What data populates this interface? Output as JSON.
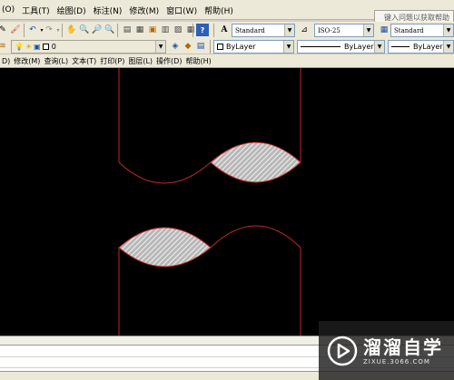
{
  "menubar": {
    "items": [
      "(O)",
      "工具(T)",
      "绘图(D)",
      "标注(N)",
      "修改(M)",
      "窗口(W)",
      "帮助(H)"
    ],
    "help_placeholder": "键入问题以获取帮助"
  },
  "toolbar1": {
    "text_style": "Standard",
    "dim_style": "ISO-25",
    "table_style": "Standard"
  },
  "toolbar2": {
    "layer": "0",
    "color": "ByLayer",
    "linetype": "ByLayer",
    "lineweight": "ByLayer"
  },
  "menubar2": {
    "items": [
      "D)",
      "修改(M)",
      "查询(L)",
      "文本(T)",
      "打印(P)",
      "图层(L)",
      "操作(D)",
      "帮助(H)"
    ]
  },
  "drawing": {
    "background": "#000000",
    "outline_color": "#c0282d",
    "hatch_color": "#ffffff"
  },
  "watermark": {
    "title": "溜溜自学",
    "url": "ZIXUE.3066.COM"
  }
}
